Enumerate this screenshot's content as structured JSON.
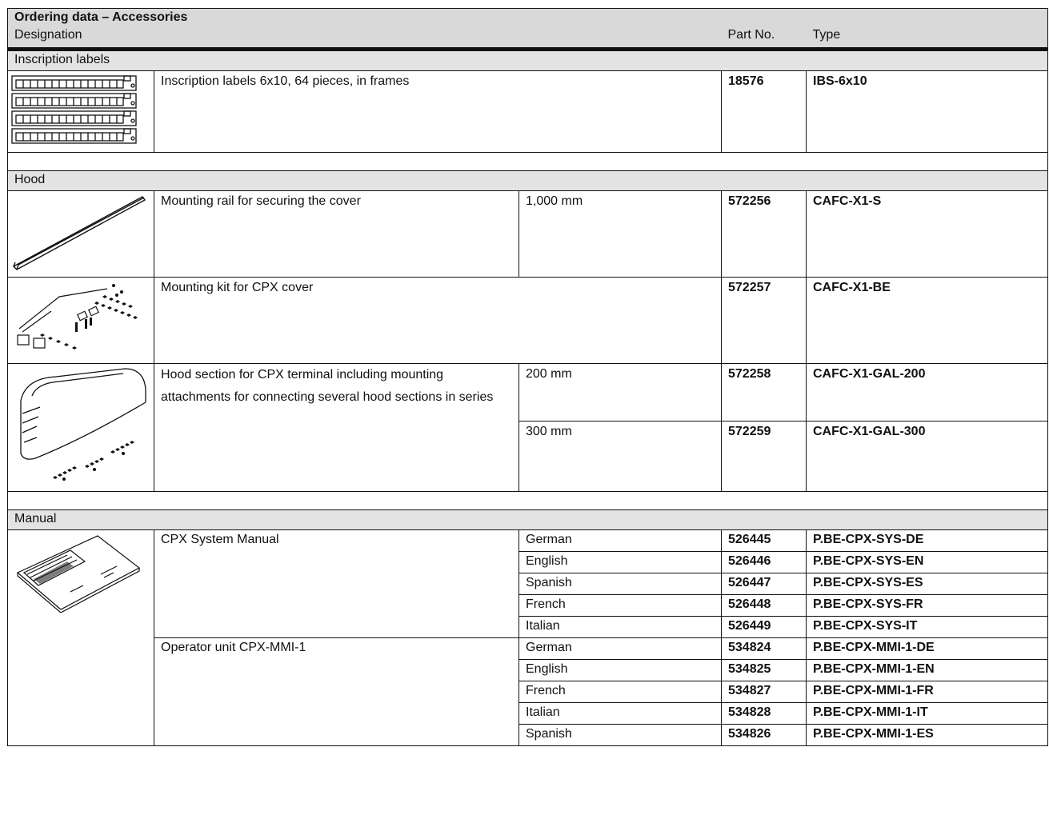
{
  "title": "Ordering data – Accessories",
  "header": {
    "designation": "Designation",
    "part_no": "Part No.",
    "type": "Type"
  },
  "sections": {
    "inscription": {
      "label": "Inscription labels",
      "row": {
        "desc": "Inscription labels 6x10, 64 pieces, in frames",
        "part_no": "18576",
        "type": "IBS-6x10"
      }
    },
    "hood": {
      "label": "Hood",
      "rail": {
        "desc": "Mounting rail for securing the cover",
        "variant": "1,000 mm",
        "part_no": "572256",
        "type": "CAFC-X1-S"
      },
      "kit": {
        "desc": "Mounting kit for CPX cover",
        "part_no": "572257",
        "type": "CAFC-X1-BE"
      },
      "hood_section": {
        "desc": "Hood section for CPX terminal including mounting attachments for connecting several hood sections in series",
        "v1": {
          "variant": "200 mm",
          "part_no": "572258",
          "type": "CAFC-X1-GAL-200"
        },
        "v2": {
          "variant": "300 mm",
          "part_no": "572259",
          "type": "CAFC-X1-GAL-300"
        }
      }
    },
    "manual": {
      "label": "Manual",
      "sys": {
        "desc": "CPX System Manual",
        "rows": [
          {
            "lang": "German",
            "part_no": "526445",
            "type": "P.BE-CPX-SYS-DE"
          },
          {
            "lang": "English",
            "part_no": "526446",
            "type": "P.BE-CPX-SYS-EN"
          },
          {
            "lang": "Spanish",
            "part_no": "526447",
            "type": "P.BE-CPX-SYS-ES"
          },
          {
            "lang": "French",
            "part_no": "526448",
            "type": "P.BE-CPX-SYS-FR"
          },
          {
            "lang": "Italian",
            "part_no": "526449",
            "type": "P.BE-CPX-SYS-IT"
          }
        ]
      },
      "mmi": {
        "desc": "Operator unit CPX-MMI-1",
        "rows": [
          {
            "lang": "German",
            "part_no": "534824",
            "type": "P.BE-CPX-MMI-1-DE"
          },
          {
            "lang": "English",
            "part_no": "534825",
            "type": "P.BE-CPX-MMI-1-EN"
          },
          {
            "lang": "French",
            "part_no": "534827",
            "type": "P.BE-CPX-MMI-1-FR"
          },
          {
            "lang": "Italian",
            "part_no": "534828",
            "type": "P.BE-CPX-MMI-1-IT"
          },
          {
            "lang": "Spanish",
            "part_no": "534826",
            "type": "P.BE-CPX-MMI-1-ES"
          }
        ]
      }
    }
  },
  "colors": {
    "header_bg": "#d9d9d9",
    "section_bg": "#e3e3e3",
    "border": "#111111"
  }
}
